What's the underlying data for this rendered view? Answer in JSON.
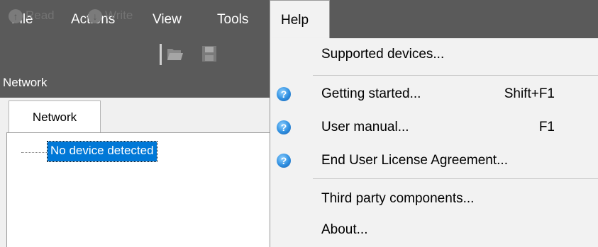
{
  "menubar": {
    "items": [
      {
        "label": "File"
      },
      {
        "label": "Actions"
      },
      {
        "label": "View"
      },
      {
        "label": "Tools"
      },
      {
        "label": "Help"
      }
    ]
  },
  "toolbar": {
    "read_label": "Read",
    "write_label": "Write"
  },
  "network_panel": {
    "title": "Network",
    "tab_label": "Network",
    "tree_node": "No device detected"
  },
  "help_menu": {
    "items": [
      {
        "label": "Supported devices...",
        "shortcut": ""
      },
      {
        "label": "Getting started...",
        "shortcut": "Shift+F1"
      },
      {
        "label": "User manual...",
        "shortcut": "F1"
      },
      {
        "label": "End User License Agreement...",
        "shortcut": ""
      },
      {
        "label": "Third party components...",
        "shortcut": ""
      },
      {
        "label": "About...",
        "shortcut": ""
      }
    ]
  },
  "colors": {
    "chrome": "#5a5a5a",
    "selection": "#0078d7",
    "menu_bg": "#f2f2f2"
  }
}
